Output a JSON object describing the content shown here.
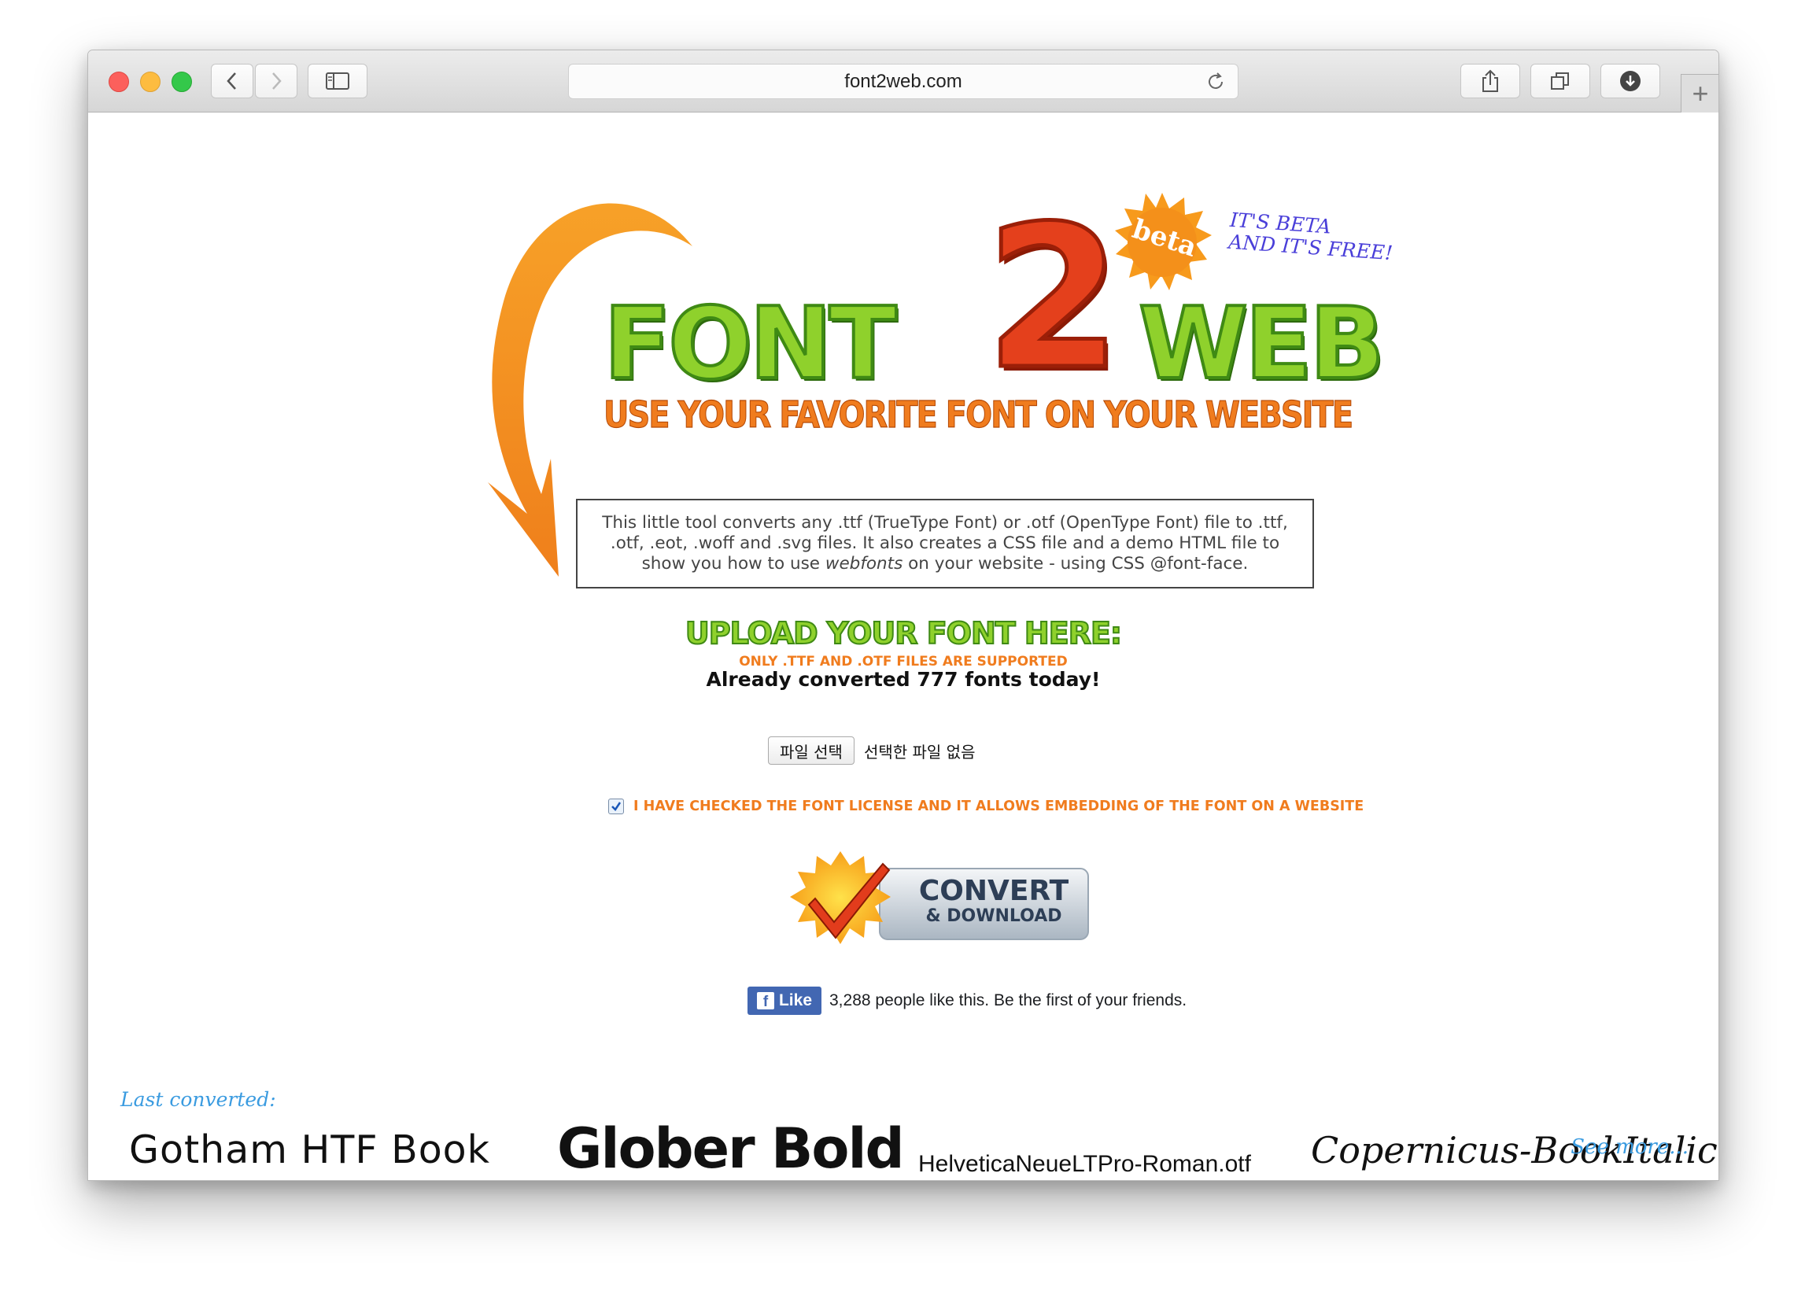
{
  "browser": {
    "url": "font2web.com"
  },
  "logo": {
    "word_left": "FONT",
    "numeral": "2",
    "word_right": "WEB",
    "tagline": "USE YOUR FAVORITE FONT ON YOUR WEBSITE",
    "badge": "beta",
    "beta_note_line1": "IT'S BETA",
    "beta_note_line2": "AND IT'S FREE!"
  },
  "description": {
    "part1": "This little tool converts any .ttf (TrueType Font) or .otf (OpenType Font) file to .ttf, .otf, .eot, .woff and .svg files. It also creates a CSS file and a demo HTML file to show you how to use ",
    "emphasis": "webfonts",
    "part2": " on your website - using CSS @font-face."
  },
  "upload": {
    "title": "UPLOAD YOUR FONT HERE:",
    "subtitle": "ONLY .TTF AND .OTF FILES ARE SUPPORTED",
    "count_text": "Already converted 777 fonts today!",
    "choose_button": "파일 선택",
    "file_status": "선택한 파일 없음"
  },
  "license": {
    "checked": true,
    "text": "I HAVE CHECKED THE FONT LICENSE AND IT ALLOWS EMBEDDING OF THE FONT ON A WEBSITE"
  },
  "convert": {
    "line1": "CONVERT",
    "line2": "& DOWNLOAD"
  },
  "facebook": {
    "button": "Like",
    "text": "3,288 people like this. Be the first of your friends."
  },
  "last_converted": {
    "label": "Last converted:",
    "fonts": [
      "Gotham HTF Book",
      "Glober Bold",
      "HelveticaNeueLTPro-Roman.otf",
      "Copernicus-BookItalic"
    ],
    "see_more": "See more..."
  },
  "colors": {
    "green": "#8fd12c",
    "orange": "#f07c1e",
    "red": "#e4401c",
    "link_blue": "#3a9be0"
  }
}
